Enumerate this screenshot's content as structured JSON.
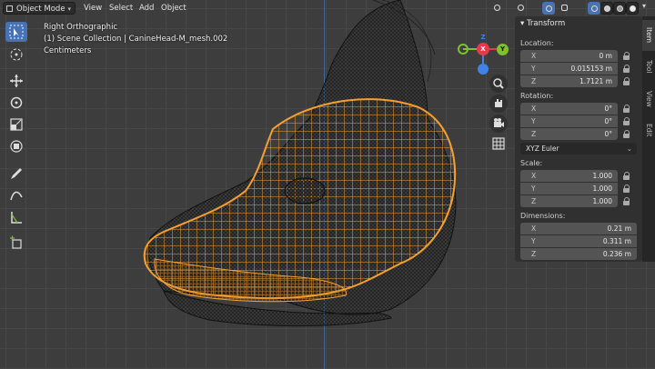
{
  "header": {
    "mode": "Object Mode",
    "menu": [
      "View",
      "Select",
      "Add",
      "Object"
    ]
  },
  "overlay": {
    "view_name": "Right Orthographic",
    "collection": "(1) Scene Collection | CanineHead-M_mesh.002",
    "units": "Centimeters"
  },
  "gizmo": {
    "y_label": "Y",
    "z_label": "Z",
    "x_label": "X"
  },
  "transform": {
    "title": "Transform",
    "location_label": "Location:",
    "location": [
      {
        "axis": "X",
        "value": "0 m"
      },
      {
        "axis": "Y",
        "value": "0.015153 m"
      },
      {
        "axis": "Z",
        "value": "1.7121 m"
      }
    ],
    "rotation_label": "Rotation:",
    "rotation": [
      {
        "axis": "X",
        "value": "0°"
      },
      {
        "axis": "Y",
        "value": "0°"
      },
      {
        "axis": "Z",
        "value": "0°"
      }
    ],
    "rotation_mode": "XYZ Euler",
    "scale_label": "Scale:",
    "scale": [
      {
        "axis": "X",
        "value": "1.000"
      },
      {
        "axis": "Y",
        "value": "1.000"
      },
      {
        "axis": "Z",
        "value": "1.000"
      }
    ],
    "dimensions_label": "Dimensions:",
    "dimensions": [
      {
        "axis": "X",
        "value": "0.21 m"
      },
      {
        "axis": "Y",
        "value": "0.311 m"
      },
      {
        "axis": "Z",
        "value": "0.236 m"
      }
    ]
  },
  "tabs": [
    "Item",
    "Tool",
    "View",
    "Edit"
  ],
  "colors": {
    "accent": "#4772b3",
    "selection": "#f5a030",
    "x_axis": "#e8394b",
    "y_axis": "#7ec02e",
    "z_axis": "#3f83e6"
  }
}
